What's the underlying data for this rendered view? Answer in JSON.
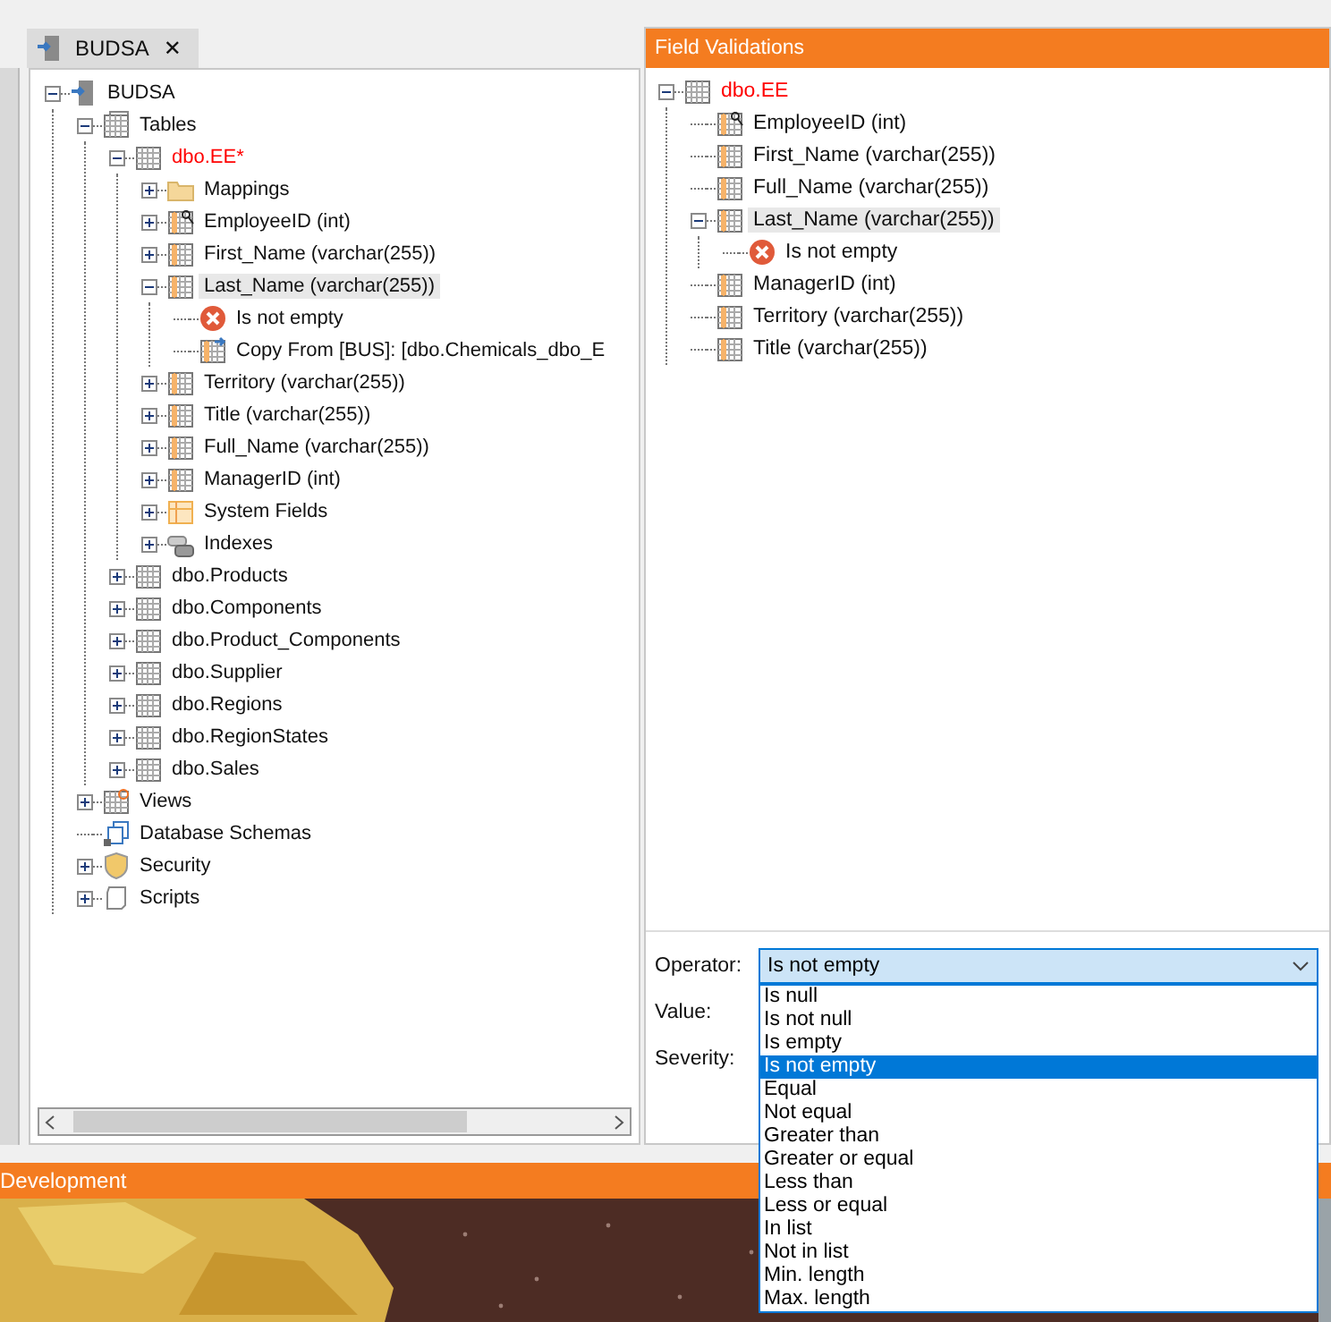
{
  "tab": {
    "title": "BUDSA",
    "close": "✕"
  },
  "explorer": {
    "tree": [
      {
        "label": "BUDSA",
        "kind": "connection",
        "expanded": true,
        "selected": false,
        "children": [
          {
            "label": "Tables",
            "kind": "tables",
            "expanded": true,
            "selected": false,
            "children": [
              {
                "label": "dbo.EE*",
                "kind": "table",
                "expanded": true,
                "selected": false,
                "color": "#ff0000",
                "children": [
                  {
                    "label": "Mappings",
                    "kind": "folder",
                    "expanded": false,
                    "selected": false
                  },
                  {
                    "label": "EmployeeID (int)",
                    "kind": "key-field",
                    "expanded": false,
                    "selected": false
                  },
                  {
                    "label": "First_Name (varchar(255))",
                    "kind": "field",
                    "expanded": false,
                    "selected": false
                  },
                  {
                    "label": "Last_Name (varchar(255))",
                    "kind": "field",
                    "expanded": true,
                    "selected": true,
                    "children": [
                      {
                        "label": "Is not empty",
                        "kind": "error",
                        "selected": false
                      },
                      {
                        "label": "Copy From [BUS]: [dbo.Chemicals_dbo_E",
                        "kind": "copy",
                        "selected": false
                      }
                    ]
                  },
                  {
                    "label": "Territory (varchar(255))",
                    "kind": "field",
                    "expanded": false,
                    "selected": false
                  },
                  {
                    "label": "Title (varchar(255))",
                    "kind": "field",
                    "expanded": false,
                    "selected": false
                  },
                  {
                    "label": "Full_Name (varchar(255))",
                    "kind": "field",
                    "expanded": false,
                    "selected": false
                  },
                  {
                    "label": "ManagerID (int)",
                    "kind": "field",
                    "expanded": false,
                    "selected": false
                  },
                  {
                    "label": "System Fields",
                    "kind": "system",
                    "expanded": false,
                    "selected": false
                  },
                  {
                    "label": "Indexes",
                    "kind": "indexes",
                    "expanded": false,
                    "selected": false
                  }
                ]
              },
              {
                "label": "dbo.Products",
                "kind": "table",
                "expanded": false,
                "selected": false
              },
              {
                "label": "dbo.Components",
                "kind": "table",
                "expanded": false,
                "selected": false
              },
              {
                "label": "dbo.Product_Components",
                "kind": "table",
                "expanded": false,
                "selected": false
              },
              {
                "label": "dbo.Supplier",
                "kind": "table",
                "expanded": false,
                "selected": false
              },
              {
                "label": "dbo.Regions",
                "kind": "table",
                "expanded": false,
                "selected": false
              },
              {
                "label": "dbo.RegionStates",
                "kind": "table",
                "expanded": false,
                "selected": false
              },
              {
                "label": "dbo.Sales",
                "kind": "table",
                "expanded": false,
                "selected": false
              }
            ]
          },
          {
            "label": "Views",
            "kind": "views",
            "expanded": false,
            "selected": false
          },
          {
            "label": "Database Schemas",
            "kind": "schemas",
            "selected": false
          },
          {
            "label": "Security",
            "kind": "security",
            "expanded": false,
            "selected": false
          },
          {
            "label": "Scripts",
            "kind": "scripts",
            "expanded": false,
            "selected": false
          }
        ]
      }
    ]
  },
  "validations": {
    "title": "Field Validations",
    "tree": [
      {
        "label": "dbo.EE",
        "kind": "table",
        "expanded": true,
        "selected": false,
        "color": "#ff0000",
        "children": [
          {
            "label": "EmployeeID (int)",
            "kind": "key-field",
            "selected": false
          },
          {
            "label": "First_Name (varchar(255))",
            "kind": "field",
            "selected": false
          },
          {
            "label": "Full_Name (varchar(255))",
            "kind": "field",
            "selected": false
          },
          {
            "label": "Last_Name (varchar(255))",
            "kind": "field",
            "expanded": true,
            "selected": true,
            "children": [
              {
                "label": "Is not empty",
                "kind": "error",
                "selected": false
              }
            ]
          },
          {
            "label": "ManagerID (int)",
            "kind": "field",
            "selected": false
          },
          {
            "label": "Territory (varchar(255))",
            "kind": "field",
            "selected": false
          },
          {
            "label": "Title (varchar(255))",
            "kind": "field",
            "selected": false
          }
        ]
      }
    ]
  },
  "form": {
    "operator_label": "Operator:",
    "value_label": "Value:",
    "severity_label": "Severity:",
    "operator": {
      "value": "Is not empty",
      "open": true,
      "options": [
        {
          "label": "Is null",
          "selected": false
        },
        {
          "label": "Is not null",
          "selected": false
        },
        {
          "label": "Is empty",
          "selected": false
        },
        {
          "label": "Is not empty",
          "selected": true
        },
        {
          "label": "Equal",
          "selected": false
        },
        {
          "label": "Not equal",
          "selected": false
        },
        {
          "label": "Greater than",
          "selected": false
        },
        {
          "label": "Greater or equal",
          "selected": false
        },
        {
          "label": "Less than",
          "selected": false
        },
        {
          "label": "Less or equal",
          "selected": false
        },
        {
          "label": "In list",
          "selected": false
        },
        {
          "label": "Not in list",
          "selected": false
        },
        {
          "label": "Min. length",
          "selected": false
        },
        {
          "label": "Max. length",
          "selected": false
        }
      ]
    }
  },
  "bottom_panel": {
    "title": "Development"
  }
}
